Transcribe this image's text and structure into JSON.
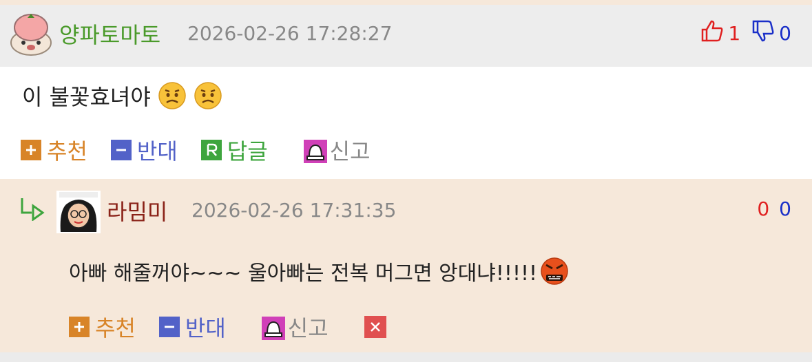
{
  "comment1": {
    "nickname": "양파토마토",
    "date": "2026-02-26 17:28:27",
    "up_count": "1",
    "down_count": "0",
    "text": "이 불꽃효녀야",
    "emojis": [
      "worried-face",
      "worried-face"
    ]
  },
  "comment2": {
    "nickname": "라밈미",
    "date": "2026-02-26 17:31:35",
    "up_count": "0",
    "down_count": "0",
    "text": "아빠 해줄꺼야~~~ 울아빠는 전복 머그면 앙대냐!!!!!",
    "emojis": [
      "face-with-symbols-on-mouth"
    ]
  },
  "actions": {
    "recommend": "추천",
    "oppose": "반대",
    "reply": "답글",
    "report": "신고"
  },
  "colors": {
    "recommend": "#d88428",
    "oppose": "#5262c8",
    "reply": "#3ea53e",
    "up": "#e02020",
    "down": "#1a2fc8",
    "nickname1": "#4a9a2a",
    "nickname2": "#8a2218"
  }
}
